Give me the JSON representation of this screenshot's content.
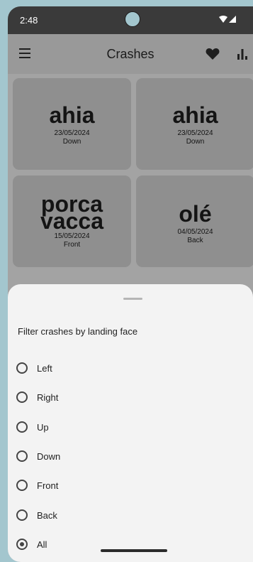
{
  "status_bar": {
    "time": "2:48",
    "icons": [
      "wifi-icon",
      "signal-icon"
    ]
  },
  "app_bar": {
    "title": "Crashes",
    "icons": [
      "menu-icon",
      "heart-icon",
      "bar-chart-icon"
    ]
  },
  "crashes": [
    {
      "title": "ahia",
      "date": "23/05/2024",
      "face": "Down"
    },
    {
      "title": "ahia",
      "date": "23/05/2024",
      "face": "Down"
    },
    {
      "title": "porca vacca",
      "date": "15/05/2024",
      "face": "Front"
    },
    {
      "title": "olé",
      "date": "04/05/2024",
      "face": "Back"
    }
  ],
  "filter_sheet": {
    "title": "Filter crashes by landing face",
    "options": [
      {
        "label": "Left",
        "selected": false
      },
      {
        "label": "Right",
        "selected": false
      },
      {
        "label": "Up",
        "selected": false
      },
      {
        "label": "Down",
        "selected": false
      },
      {
        "label": "Front",
        "selected": false
      },
      {
        "label": "Back",
        "selected": false
      },
      {
        "label": "All",
        "selected": true
      }
    ]
  },
  "colors": {
    "backdrop": "#a3c6ce",
    "scrim": "#a3a3a3",
    "card": "#8f8f8f",
    "sheet": "#f3f3f3",
    "status_bar": "#3a3a3a"
  }
}
